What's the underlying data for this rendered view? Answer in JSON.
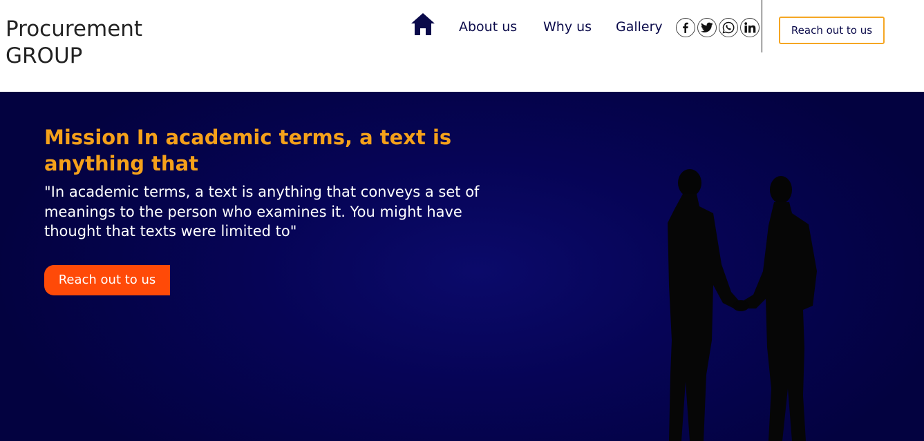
{
  "header": {
    "logo_line1": "Procurement",
    "logo_line2": "GROUP",
    "nav": {
      "home_icon": "home-icon",
      "about": "About us",
      "why": "Why us",
      "gallery": "Gallery"
    },
    "social_icons": [
      "facebook-icon",
      "twitter-icon",
      "whatsapp-icon",
      "linkedin-icon"
    ],
    "cta": "Reach out to us"
  },
  "hero": {
    "title": "Mission In academic terms, a text is anything that",
    "text": "\"In academic terms, a text is anything that conveys a set of meanings to the person who examines it. You might have thought that texts were limited to\"",
    "cta": "Reach out to us",
    "image": "business-handshake-silhouette"
  },
  "colors": {
    "nav_text": "#0a0a4a",
    "hero_bg": "#05034f",
    "hero_title": "#f5a11a",
    "hero_cta_bg": "#ff4a08",
    "header_cta_border": "#f5a623"
  }
}
